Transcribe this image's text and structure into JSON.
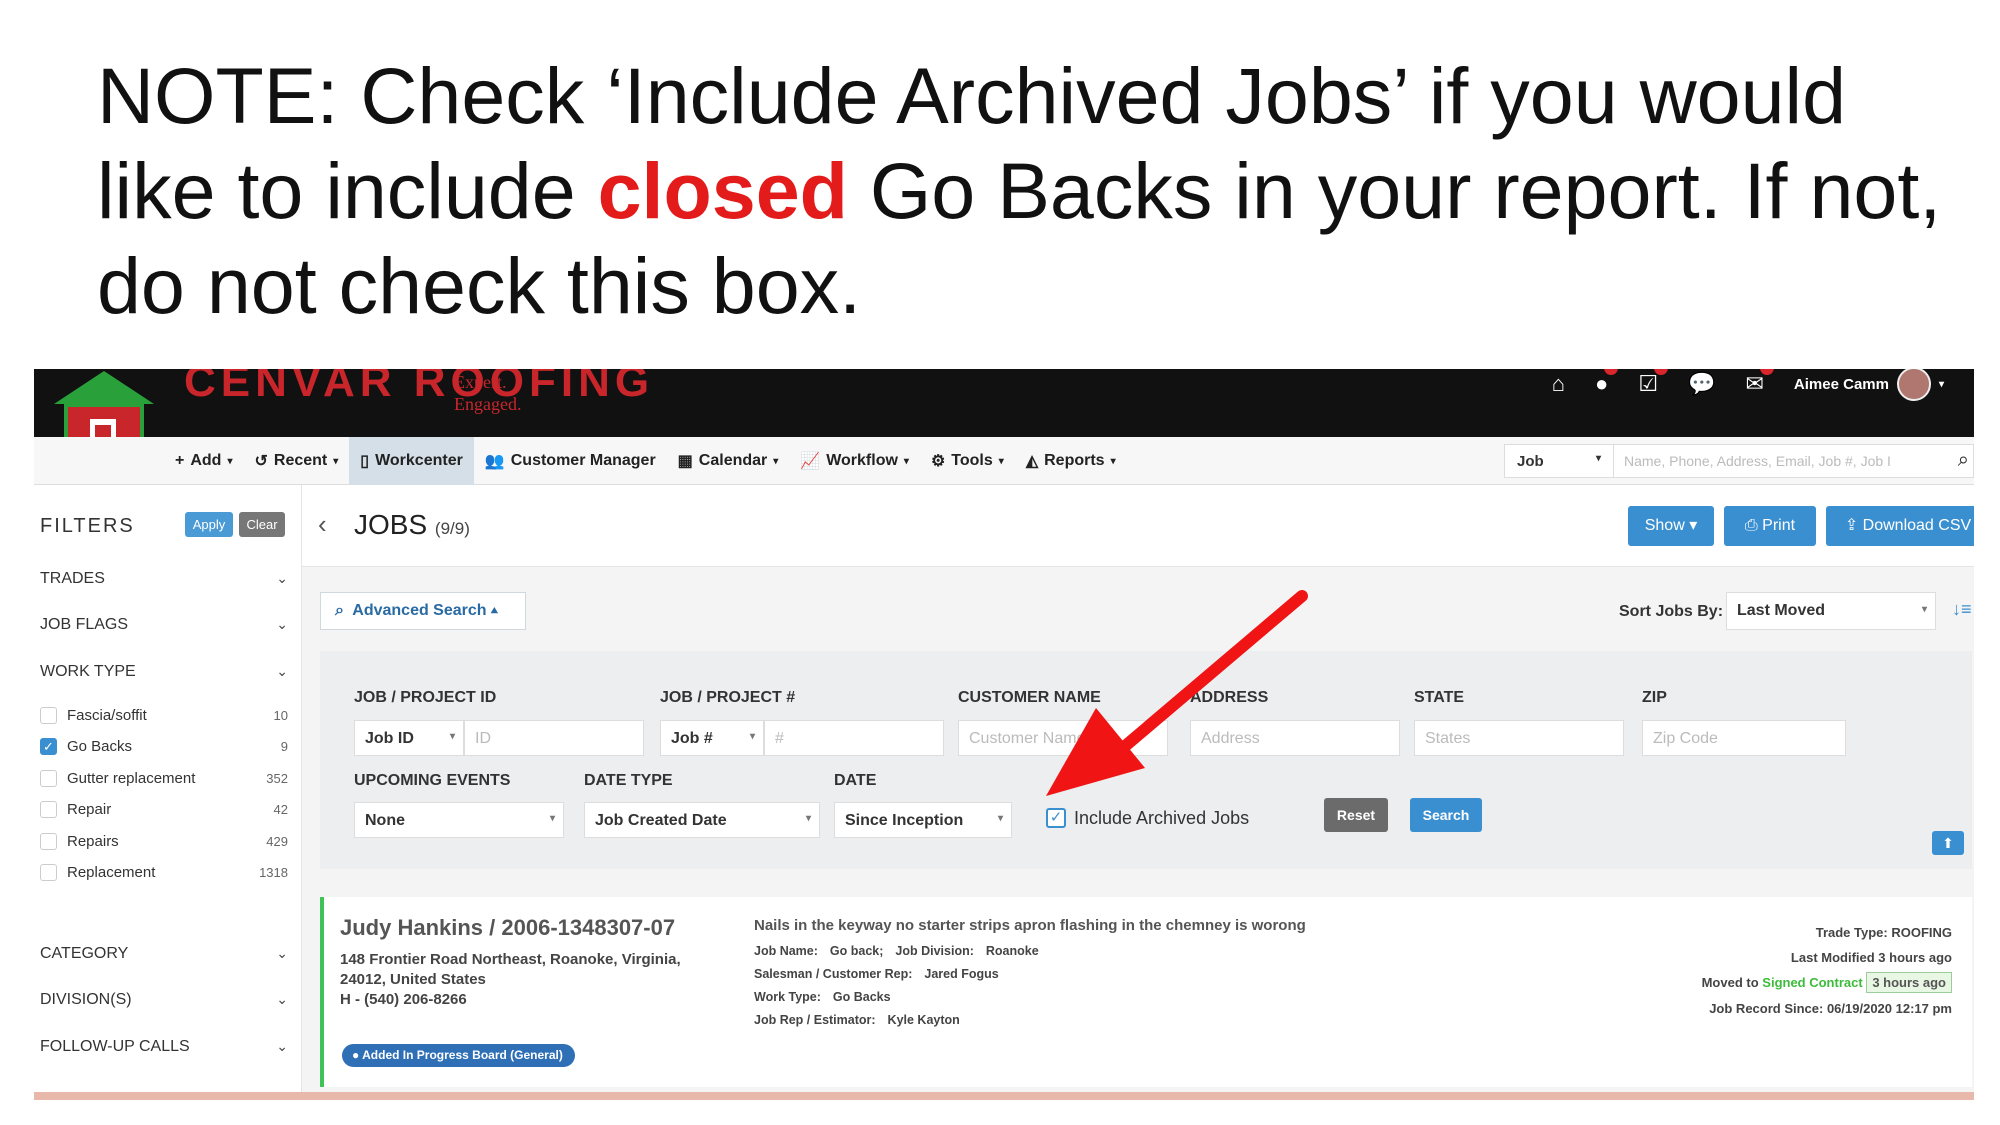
{
  "note": {
    "part1": "NOTE:  Check ‘Include Archived Jobs’  if you would like to include ",
    "highlight": "closed",
    "part2": " Go Backs in your report. If not, do not check this box."
  },
  "brand": {
    "name": "CENVAR ROOFING",
    "tagline_1": "Expert.",
    "tagline_2": "Engaged."
  },
  "topbar": {
    "user_name": "Aimee Camm"
  },
  "nav": {
    "add": "Add",
    "recent": "Recent",
    "workcenter": "Workcenter",
    "customer_manager": "Customer Manager",
    "calendar": "Calendar",
    "workflow": "Workflow",
    "tools": "Tools",
    "reports": "Reports",
    "search_type": "Job",
    "search_placeholder": "Name, Phone, Address, Email, Job #, Job I"
  },
  "sidebar": {
    "title": "FILTERS",
    "apply": "Apply",
    "clear": "Clear",
    "sections": {
      "trades": "TRADES",
      "job_flags": "JOB FLAGS",
      "work_type": "WORK TYPE",
      "category": "CATEGORY",
      "divisions": "DIVISION(S)",
      "followup": "FOLLOW-UP CALLS"
    },
    "work_types": [
      {
        "label": "Fascia/soffit",
        "count": "10",
        "checked": false
      },
      {
        "label": "Go Backs",
        "count": "9",
        "checked": true
      },
      {
        "label": "Gutter replacement",
        "count": "352",
        "checked": false
      },
      {
        "label": "Repair",
        "count": "42",
        "checked": false
      },
      {
        "label": "Repairs",
        "count": "429",
        "checked": false
      },
      {
        "label": "Replacement",
        "count": "1318",
        "checked": false
      }
    ]
  },
  "jobs": {
    "title": "JOBS",
    "count": "(9/9)",
    "show": "Show",
    "print": "Print",
    "download": "Download CSV",
    "advanced_search": "Advanced Search",
    "sort_label": "Sort Jobs By:",
    "sort_value": "Last Moved"
  },
  "advanced": {
    "job_project_id_label": "JOB / PROJECT ID",
    "job_id_select": "Job ID",
    "id_placeholder": "ID",
    "job_project_num_label": "JOB / PROJECT #",
    "job_num_select": "Job #",
    "num_placeholder": "#",
    "customer_name_label": "CUSTOMER NAME",
    "customer_placeholder": "Customer Name",
    "address_label": "ADDRESS",
    "address_placeholder": "Address",
    "state_label": "STATE",
    "state_placeholder": "States",
    "zip_label": "ZIP",
    "zip_placeholder": "Zip Code",
    "upcoming_label": "UPCOMING EVENTS",
    "upcoming_value": "None",
    "date_type_label": "DATE TYPE",
    "date_type_value": "Job Created Date",
    "date_label": "DATE",
    "date_value": "Since Inception",
    "include_archived": "Include Archived Jobs",
    "include_archived_checked": true,
    "reset": "Reset",
    "search": "Search"
  },
  "job_card": {
    "name": "Judy Hankins / 2006-1348307-07",
    "address_1": "148 Frontier Road Northeast, Roanoke, Virginia,",
    "address_2": "24012, United States",
    "phone": "H - (540) 206-8266",
    "badge": "Added In Progress Board (General)",
    "description": "Nails in the keyway no starter strips apron flashing in the chemney is worong",
    "job_name_label": "Job Name:",
    "job_name_value": "Go back;",
    "division_label": "Job Division:",
    "division_value": "Roanoke",
    "salesman_label": "Salesman / Customer Rep:",
    "salesman_value": "Jared Fogus",
    "work_type_label": "Work Type:",
    "work_type_value": "Go Backs",
    "rep_label": "Job Rep / Estimator:",
    "rep_value": "Kyle Kayton",
    "trade_type": "Trade Type: ROOFING",
    "last_modified": "Last Modified 3 hours ago",
    "moved_to_label": "Moved to",
    "moved_to_stage": "Signed Contract",
    "moved_ago": "3 hours ago",
    "record_since": "Job Record Since: 06/19/2020 12:17 pm"
  },
  "colors": {
    "accent": "#3a8fd0",
    "brand_red": "#c8262b",
    "highlight_red": "#e31b1b",
    "arrow_red": "#f01414",
    "success_green": "#3dbb3a"
  }
}
